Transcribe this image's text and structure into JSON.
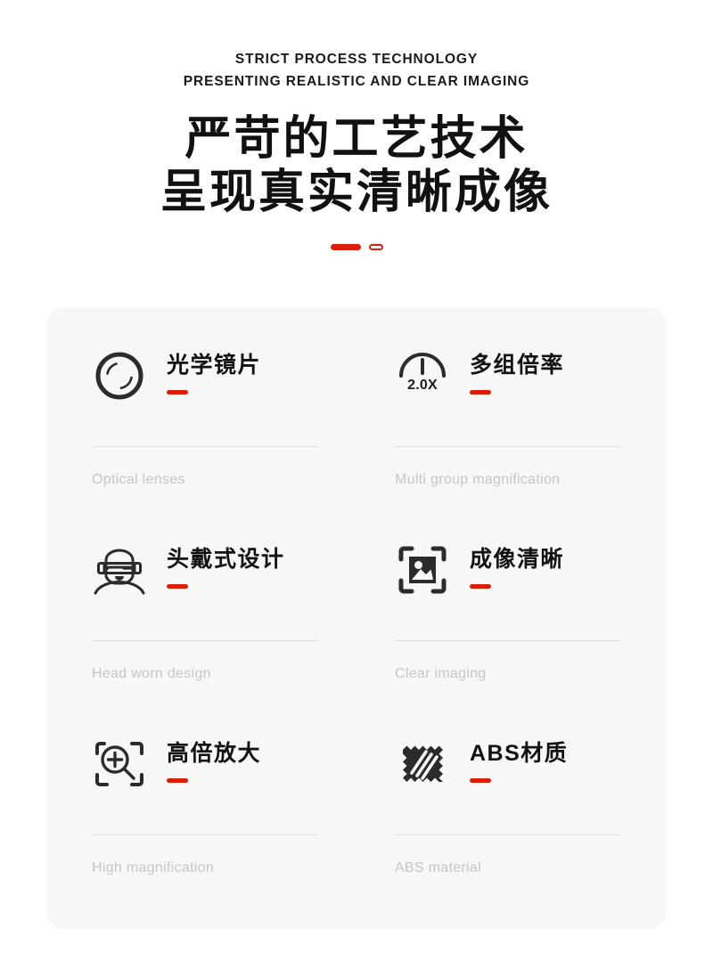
{
  "header": {
    "eyebrow_line1": "STRICT PROCESS TECHNOLOGY",
    "eyebrow_line2": "PRESENTING REALISTIC AND CLEAR IMAGING",
    "headline_line1": "严苛的工艺技术",
    "headline_line2": "呈现真实清晰成像"
  },
  "colors": {
    "accent_red": "#d81e06",
    "card_background": "#f7f7f7",
    "page_background": "#ffffff",
    "icon_dark": "#2b2b2b",
    "caption_gray": "#c6c6c6",
    "rule_gray": "#dddddd"
  },
  "features": [
    {
      "icon": "optical-lens-icon",
      "zh": "光学镜片",
      "en": "Optical lenses"
    },
    {
      "icon": "magnification-gauge-icon",
      "zh": "多组倍率",
      "en": "Multi group magnification",
      "icon_label": "2.0X"
    },
    {
      "icon": "head-mounted-vr-icon",
      "zh": "头戴式设计",
      "en": "Head worn design"
    },
    {
      "icon": "clear-image-frame-icon",
      "zh": "成像清晰",
      "en": "Clear imaging"
    },
    {
      "icon": "magnifier-plus-icon",
      "zh": "高倍放大",
      "en": "High magnification"
    },
    {
      "icon": "abs-fabric-swatch-icon",
      "zh": "ABS材质",
      "en": "ABS material"
    }
  ]
}
